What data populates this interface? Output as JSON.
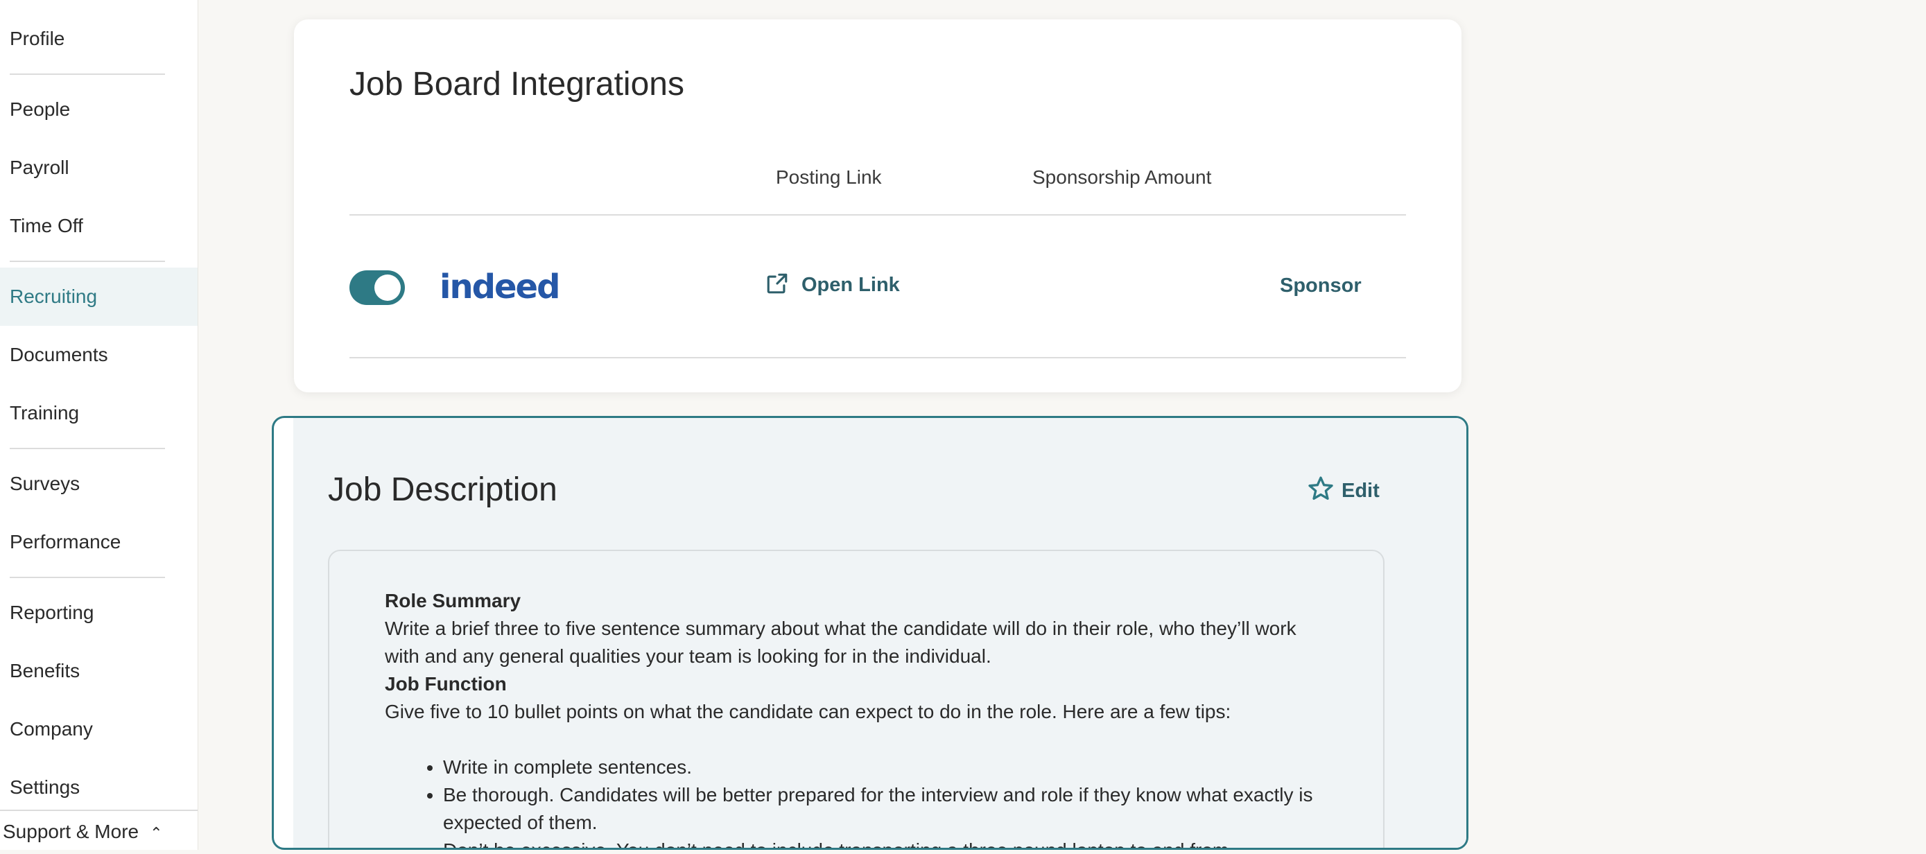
{
  "sidebar": {
    "items": [
      {
        "label": "Profile",
        "active": false
      },
      {
        "label": "People",
        "active": false
      },
      {
        "label": "Payroll",
        "active": false
      },
      {
        "label": "Time Off",
        "active": false
      },
      {
        "label": "Recruiting",
        "active": true
      },
      {
        "label": "Documents",
        "active": false
      },
      {
        "label": "Training",
        "active": false
      },
      {
        "label": "Surveys",
        "active": false
      },
      {
        "label": "Performance",
        "active": false
      },
      {
        "label": "Reporting",
        "active": false
      },
      {
        "label": "Benefits",
        "active": false
      },
      {
        "label": "Company",
        "active": false
      },
      {
        "label": "Settings",
        "active": false
      }
    ],
    "support_label": "Support & More"
  },
  "job_board": {
    "title": "Job Board Integrations",
    "columns": {
      "posting_link": "Posting Link",
      "sponsorship_amount": "Sponsorship Amount"
    },
    "row": {
      "enabled": true,
      "board_name": "indeed",
      "open_link_label": "Open Link",
      "sponsor_label": "Sponsor"
    }
  },
  "job_description": {
    "title": "Job Description",
    "edit_label": "Edit",
    "content": {
      "role_summary_heading": "Role Summary",
      "role_summary_text": "Write a brief three to five sentence summary about what the candidate will do in their role, who they’ll work with and any general qualities your team is looking for in the individual.",
      "job_function_heading": "Job Function",
      "job_function_text": "Give five to 10 bullet points on what the candidate can expect to do in the role. Here are a few tips:",
      "bullets": [
        "Write in complete sentences.",
        "Be thorough. Candidates will be better prepared for the interview and role if they know what exactly is expected of them.",
        "Don’t be excessive. You don’t need to include transporting a three pound laptop to and from"
      ]
    }
  },
  "colors": {
    "accent": "#2e7a85",
    "link": "#2e5f6b",
    "indeed_blue": "#2557a7"
  }
}
